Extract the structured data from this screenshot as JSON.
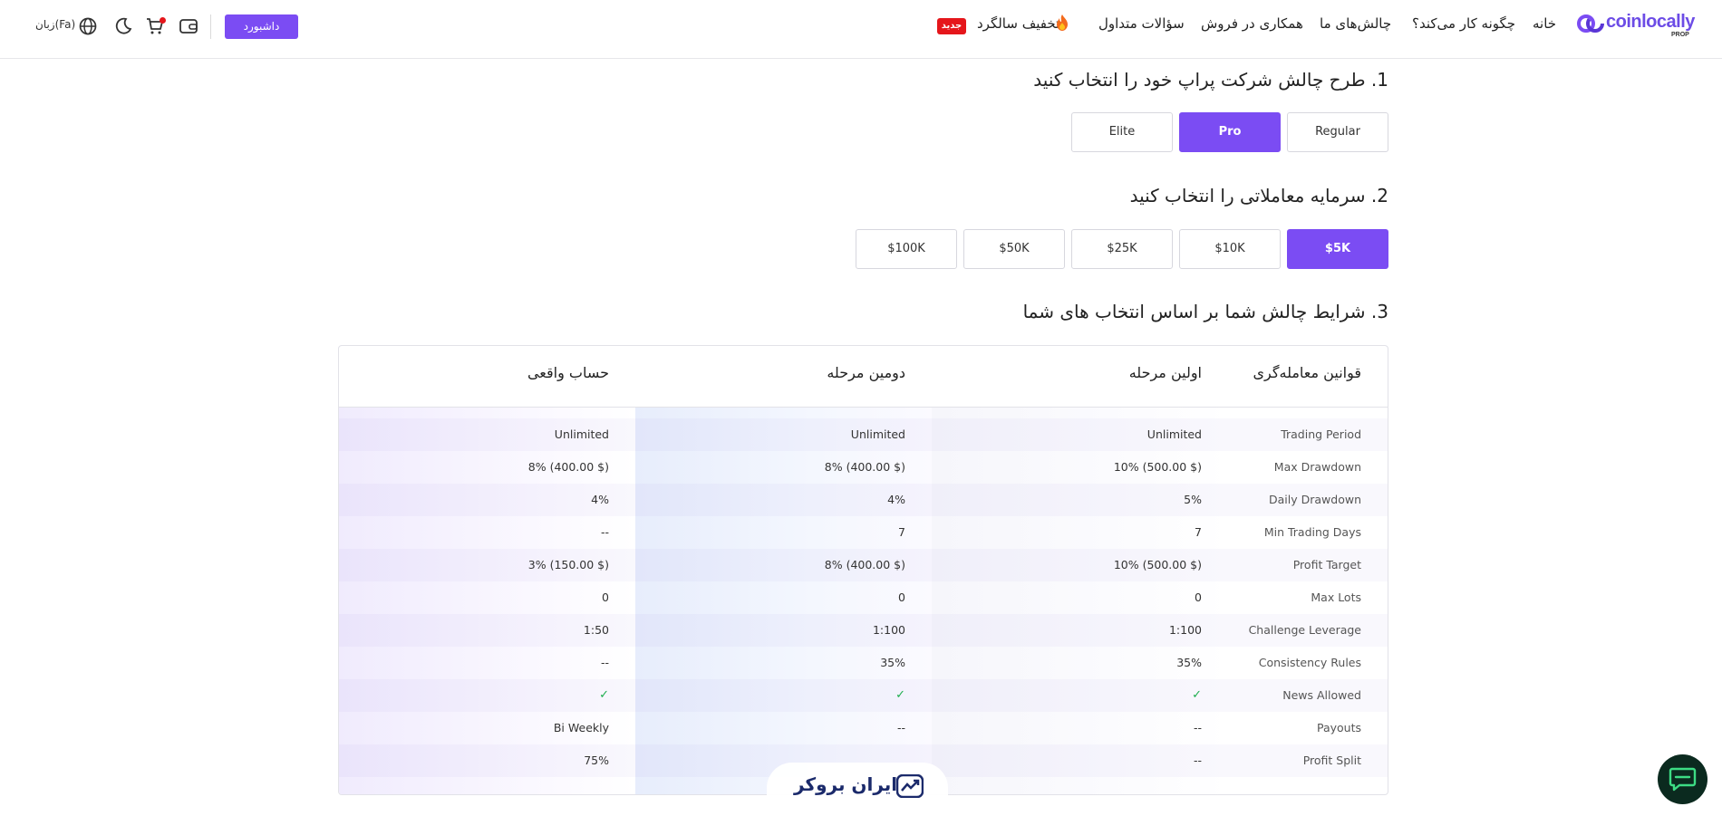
{
  "header": {
    "logo": {
      "name": "coinlocally",
      "sub": "PROP"
    },
    "nav": [
      {
        "label": "خانه"
      },
      {
        "label": "چگونه کار می‌کند؟"
      },
      {
        "label": "چالش‌های ما"
      },
      {
        "label": "همکاری در فروش"
      },
      {
        "label": "سؤالات متداول"
      },
      {
        "label": "تخفیف سالگرد"
      }
    ],
    "new_badge": "جدید",
    "dashboard_label": "داشبورد",
    "language_label": "زبان(Fa)",
    "icons": [
      "wallet-icon",
      "cart-icon",
      "moon-icon",
      "globe-icon"
    ],
    "accent": "#7b4cf3"
  },
  "step1": {
    "title": "1. طرح چالش شرکت پراپ خود را انتخاب کنید",
    "plans": [
      "Regular",
      "Pro",
      "Elite"
    ],
    "selected": "Pro"
  },
  "step2": {
    "title": "2. سرمایه معاملاتی را انتخاب کنید",
    "amounts": [
      "$5K",
      "$10K",
      "$25K",
      "$50K",
      "$100K"
    ],
    "selected": "$5K"
  },
  "step3": {
    "title": "3. شرایط چالش شما بر اساس انتخاب های شما",
    "columns": [
      "قوانین معامله‌گری",
      "اولین مرحله",
      "دومین مرحله",
      "حساب واقعی"
    ],
    "rows": [
      {
        "rule": "Trading Period",
        "phase1": "Unlimited",
        "phase2": "Unlimited",
        "real": "Unlimited"
      },
      {
        "rule": "Max Drawdown",
        "phase1": "10% (500.00 $)",
        "phase2": "8% (400.00 $)",
        "real": "8% (400.00 $)"
      },
      {
        "rule": "Daily Drawdown",
        "phase1": "5%",
        "phase2": "4%",
        "real": "4%"
      },
      {
        "rule": "Min Trading Days",
        "phase1": "7",
        "phase2": "7",
        "real": "--"
      },
      {
        "rule": "Profit Target",
        "phase1": "10% (500.00 $)",
        "phase2": "8% (400.00 $)",
        "real": "3% (150.00 $)"
      },
      {
        "rule": "Max Lots",
        "phase1": "0",
        "phase2": "0",
        "real": "0"
      },
      {
        "rule": "Challenge Leverage",
        "phase1": "1:100",
        "phase2": "1:100",
        "real": "1:50"
      },
      {
        "rule": "Consistency Rules",
        "phase1": "35%",
        "phase2": "35%",
        "real": "--"
      },
      {
        "rule": "News Allowed",
        "phase1": "✓",
        "phase2": "✓",
        "real": "✓"
      },
      {
        "rule": "Payouts",
        "phase1": "--",
        "phase2": "--",
        "real": "Bi Weekly"
      },
      {
        "rule": "Profit Split",
        "phase1": "--",
        "phase2": "",
        "real": "75%"
      }
    ]
  },
  "watermark": {
    "text": "ایران بروکر"
  },
  "chat": {
    "icon": "chat-icon"
  }
}
